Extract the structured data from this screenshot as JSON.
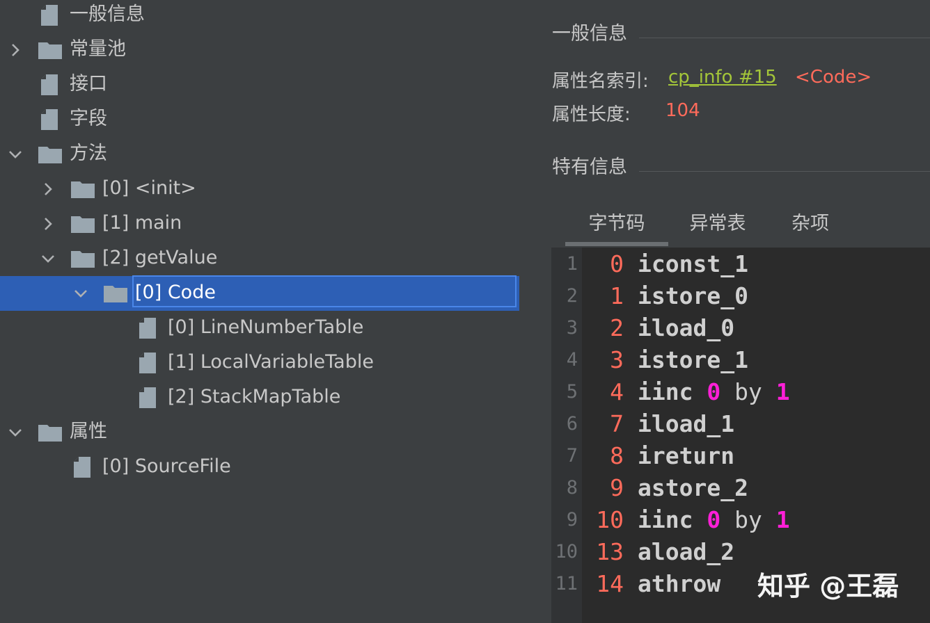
{
  "tree": {
    "items": [
      {
        "label": "一般信息",
        "icon": "file-icon",
        "expander": "none"
      },
      {
        "label": "常量池",
        "icon": "folder-icon",
        "expander": "collapsed"
      },
      {
        "label": "接口",
        "icon": "file-icon",
        "expander": "none"
      },
      {
        "label": "字段",
        "icon": "file-icon",
        "expander": "none"
      },
      {
        "label": "方法",
        "icon": "folder-icon",
        "expander": "expanded"
      },
      {
        "label": "[0] <init>",
        "icon": "folder-icon",
        "expander": "collapsed"
      },
      {
        "label": "[1] main",
        "icon": "folder-icon",
        "expander": "collapsed"
      },
      {
        "label": "[2] getValue",
        "icon": "folder-icon",
        "expander": "expanded"
      },
      {
        "label": "[0] Code",
        "icon": "folder-icon",
        "expander": "expanded",
        "selected": true
      },
      {
        "label": "[0] LineNumberTable",
        "icon": "file-icon",
        "expander": "none"
      },
      {
        "label": "[1] LocalVariableTable",
        "icon": "file-icon",
        "expander": "none"
      },
      {
        "label": "[2] StackMapTable",
        "icon": "file-icon",
        "expander": "none"
      },
      {
        "label": "属性",
        "icon": "folder-icon",
        "expander": "expanded"
      },
      {
        "label": "[0] SourceFile",
        "icon": "file-icon",
        "expander": "none"
      }
    ]
  },
  "detail": {
    "general_title": "一般信息",
    "attr_name_index_label": "属性名索引:",
    "attr_name_index_link": "cp_info #15",
    "attr_name_index_value": "<Code>",
    "attr_length_label": "属性长度:",
    "attr_length_value": "104",
    "specific_title": "特有信息",
    "tabs": [
      {
        "label": "字节码",
        "active": true
      },
      {
        "label": "异常表",
        "active": false
      },
      {
        "label": "杂项",
        "active": false
      }
    ],
    "bytecode": [
      {
        "line": "1",
        "offset": "0",
        "op": "iconst_1"
      },
      {
        "line": "2",
        "offset": "1",
        "op": "istore_0"
      },
      {
        "line": "3",
        "offset": "2",
        "op": "iload_0"
      },
      {
        "line": "4",
        "offset": "3",
        "op": "istore_1"
      },
      {
        "line": "5",
        "offset": "4",
        "op": "iinc",
        "arg1": "0",
        "mid": "by",
        "arg2": "1"
      },
      {
        "line": "6",
        "offset": "7",
        "op": "iload_1"
      },
      {
        "line": "7",
        "offset": "8",
        "op": "ireturn"
      },
      {
        "line": "8",
        "offset": "9",
        "op": "astore_2"
      },
      {
        "line": "9",
        "offset": "10",
        "op": "iinc",
        "arg1": "0",
        "mid": "by",
        "arg2": "1"
      },
      {
        "line": "10",
        "offset": "13",
        "op": "aload_2"
      },
      {
        "line": "11",
        "offset": "14",
        "op": "athrow"
      }
    ]
  },
  "watermark": "知乎 @王磊",
  "colors": {
    "background": "#3c3f41",
    "selection": "#2d5fb5",
    "code_background": "#2b2b2b",
    "offset": "#ff6b5b",
    "link": "#a4c639",
    "operand": "#ff1fd8"
  }
}
